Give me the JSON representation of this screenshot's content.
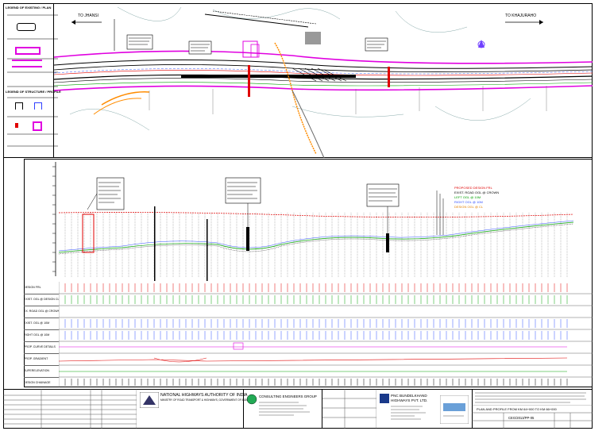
{
  "plan": {
    "direction_left": "TO JHANSI",
    "direction_right": "TO KHAJURAHO"
  },
  "legend": {
    "title": "LEGEND OF EXISTING / PLAN",
    "title2": "LEGEND OF STRUCTURE / PROFILE"
  },
  "profile": {
    "rows": [
      "DESIGN FRL",
      "EXIST. OGL @ DESIGN CL",
      "EX. ROAD OGL @ CROWN",
      "EXIST. OGL @ 10M",
      "RIGHT OGL @ 10M",
      "PROP. CURVE DETAILS",
      "PROP. GRADIENT",
      "SUPERELEVATION",
      "DESIGN CHAINAGE"
    ],
    "legend_lines": [
      "PROPOSED DESIGN FRL",
      "EXIST. ROAD OGL @ CROWN",
      "LEFT OGL @ 10M",
      "RIGHT OGL @ 10M",
      "DESIGN OGL @ CL"
    ]
  },
  "title_block": {
    "client_name": "NATIONAL HIGHWAYS AUTHORITY OF INDIA",
    "client_sub": "MINISTRY OF ROAD TRANSPORT & HIGHWAYS, GOVERNMENT OF INDIA",
    "consultant_name": "CONSULTING ENGINEERS GROUP",
    "contractor_name": "PNC BUNDELKHAND HIGHWAYS PVT. LTD.",
    "drawing_title": "PLAN AND PROFILE FROM KM 64+000 TO KM 66+000",
    "drawing_no": "CEG/2013/PP-05"
  }
}
